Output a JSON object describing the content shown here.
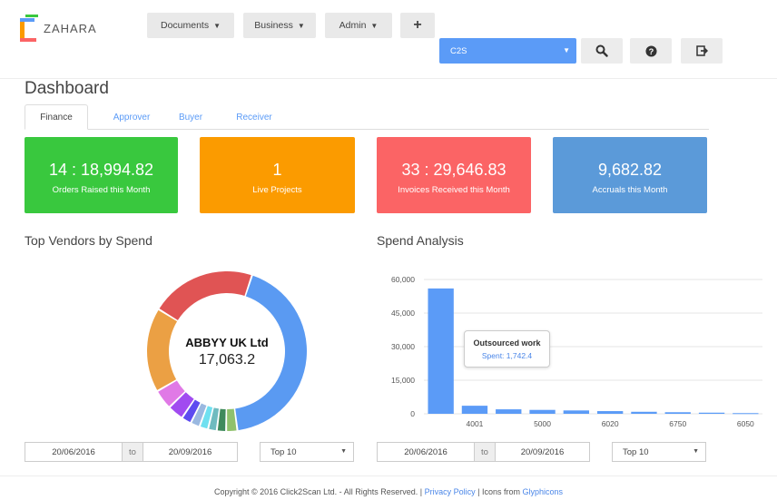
{
  "app": {
    "logo_text": "ZAHARA"
  },
  "nav": {
    "documents": "Documents",
    "business": "Business",
    "admin": "Admin",
    "add": "+"
  },
  "company_select": {
    "value": "C2S"
  },
  "page": {
    "title": "Dashboard"
  },
  "tabs": [
    "Finance",
    "Approver",
    "Buyer",
    "Receiver"
  ],
  "cards": [
    {
      "value": "14 : 18,994.82",
      "label": "Orders Raised this Month",
      "color": "#39c83e"
    },
    {
      "value": "1",
      "label": "Live Projects",
      "color": "#fb9b00"
    },
    {
      "value": "33 : 29,646.83",
      "label": "Invoices Received this Month",
      "color": "#fb6465"
    },
    {
      "value": "9,682.82",
      "label": "Accruals this Month",
      "color": "#5b9ad9"
    }
  ],
  "sections": {
    "vendors": "Top Vendors by Spend",
    "spend": "Spend Analysis"
  },
  "donut": {
    "center_name": "ABBYY UK Ltd",
    "center_value": "17,063.2"
  },
  "tooltip": {
    "title": "Outsourced work",
    "text": "Spent: 1,742.4"
  },
  "filters": {
    "left": {
      "from": "20/06/2016",
      "to_label": "to",
      "to": "20/09/2016",
      "top": "Top 10"
    },
    "right": {
      "from": "20/06/2016",
      "to_label": "to",
      "to": "20/09/2016",
      "top": "Top 10"
    }
  },
  "footer": {
    "copyright": "Copyright © 2016 Click2Scan Ltd. - All Rights Reserved. |",
    "privacy": "Privacy Policy",
    "icons_from": "| Icons from",
    "glyphicons": "Glyphicons"
  },
  "chart_data": [
    {
      "type": "pie",
      "donut": true,
      "slices": [
        {
          "value": 17063.2,
          "color": "#5a9af2"
        },
        {
          "value": 900,
          "color": "#8fc16c"
        },
        {
          "value": 750,
          "color": "#3f8a5c"
        },
        {
          "value": 700,
          "color": "#6fbbbf"
        },
        {
          "value": 700,
          "color": "#6fe0f0"
        },
        {
          "value": 750,
          "color": "#9ab8e0"
        },
        {
          "value": 800,
          "color": "#5d4bf0"
        },
        {
          "value": 1300,
          "color": "#a14bf0"
        },
        {
          "value": 1600,
          "color": "#e079e6"
        },
        {
          "value": 6800,
          "color": "#eba044"
        },
        {
          "value": 8500,
          "color": "#e05454"
        }
      ]
    },
    {
      "type": "bar",
      "categories": [
        "",
        "4001",
        "",
        "5000",
        "",
        "6020",
        "",
        "6750",
        "",
        "6050"
      ],
      "values": [
        56000,
        3600,
        2000,
        1742.4,
        1500,
        1200,
        900,
        700,
        500,
        300
      ],
      "yticks": [
        "0",
        "15,000",
        "30,000",
        "45,000",
        "60,000"
      ],
      "ylim": [
        0,
        60000
      ],
      "color": "#5b9bf7"
    }
  ]
}
